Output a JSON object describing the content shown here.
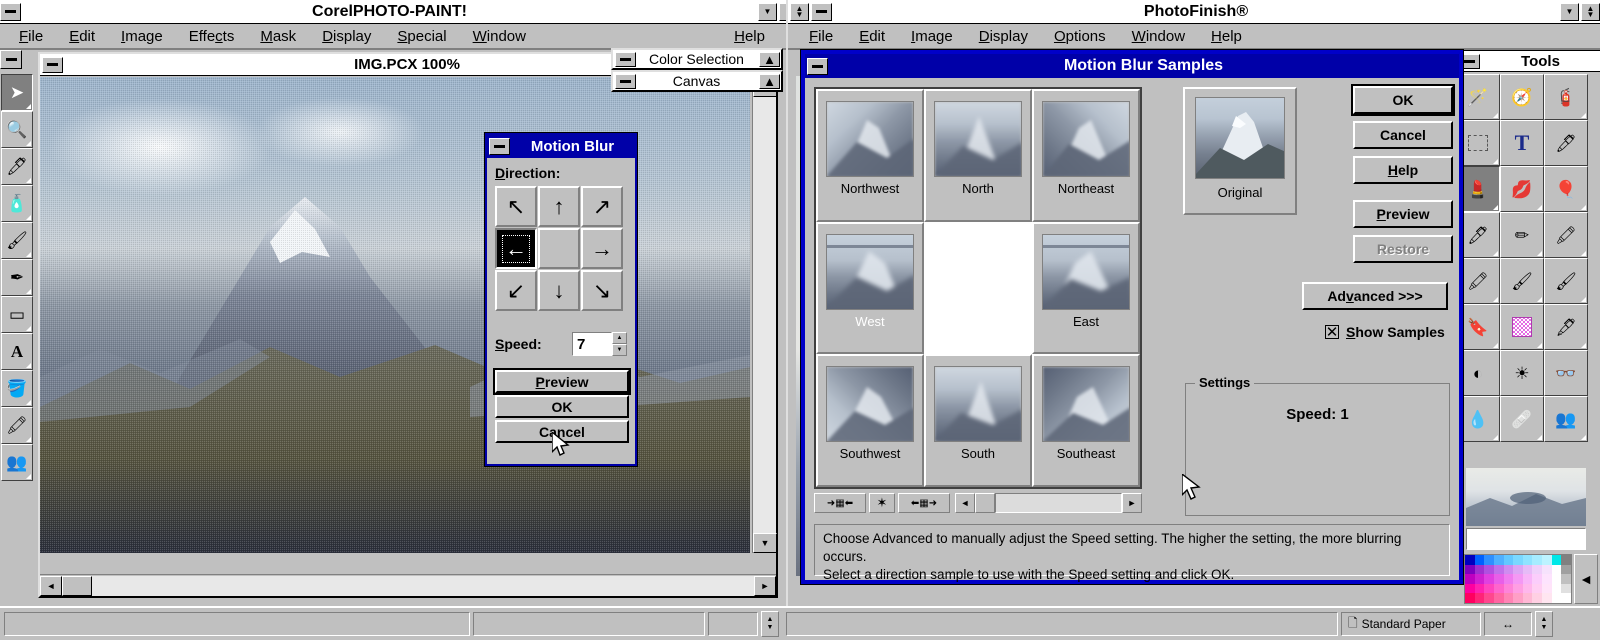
{
  "left_app": {
    "title": "CorelPHOTO-PAINT!",
    "menus": [
      {
        "label": "File",
        "accel": "F"
      },
      {
        "label": "Edit",
        "accel": "E"
      },
      {
        "label": "Image",
        "accel": "I"
      },
      {
        "label": "Effects",
        "accel": "c"
      },
      {
        "label": "Mask",
        "accel": "M"
      },
      {
        "label": "Display",
        "accel": "D"
      },
      {
        "label": "Special",
        "accel": "S"
      },
      {
        "label": "Window",
        "accel": "W"
      }
    ],
    "help_label": "Help",
    "document": {
      "title": "IMG.PCX  100%"
    },
    "panels": [
      {
        "label": "Color Selection"
      },
      {
        "label": "Canvas"
      }
    ],
    "tools": [
      {
        "name": "pick-tool",
        "glyph": "➤",
        "selected": true
      },
      {
        "name": "zoom-tool",
        "glyph": "🔍",
        "selected": false
      },
      {
        "name": "eyedropper-tool",
        "glyph": "🖊",
        "selected": false
      },
      {
        "name": "airbrush-tool",
        "glyph": "🧴",
        "selected": false
      },
      {
        "name": "paint-tool",
        "glyph": "🖌",
        "selected": false
      },
      {
        "name": "brush-tool",
        "glyph": "✒",
        "selected": false
      },
      {
        "name": "rectangle-tool",
        "glyph": "▭",
        "selected": false
      },
      {
        "name": "text-tool",
        "glyph": "A",
        "selected": false
      },
      {
        "name": "fill-tool",
        "glyph": "🪣",
        "selected": false
      },
      {
        "name": "clone-tool",
        "glyph": "🖍",
        "selected": false
      },
      {
        "name": "people-tool",
        "glyph": "👥",
        "selected": false
      }
    ]
  },
  "right_app": {
    "title": "PhotoFinish®",
    "menus": [
      {
        "label": "File",
        "accel": "F"
      },
      {
        "label": "Edit",
        "accel": "E"
      },
      {
        "label": "Image",
        "accel": "I"
      },
      {
        "label": "Display",
        "accel": "D"
      },
      {
        "label": "Options",
        "accel": "O"
      },
      {
        "label": "Window",
        "accel": "W"
      },
      {
        "label": "Help",
        "accel": "H"
      }
    ],
    "tools_panel_title": "Tools",
    "tool_icons": [
      {
        "name": "magic-wand-tool",
        "glyph": "🪄"
      },
      {
        "name": "compass-tool",
        "glyph": "🧭"
      },
      {
        "name": "spray-can-tool",
        "glyph": "🧯"
      },
      {
        "name": "marquee-select-tool",
        "glyph": "⬚"
      },
      {
        "name": "text-tool",
        "glyph": "T"
      },
      {
        "name": "eyedropper-tool",
        "glyph": "🖊"
      },
      {
        "name": "lipstick-tool",
        "glyph": "💄"
      },
      {
        "name": "smear-tool",
        "glyph": "💋"
      },
      {
        "name": "airbrush-tool",
        "glyph": "🎈"
      },
      {
        "name": "marker-tool",
        "glyph": "🖊"
      },
      {
        "name": "pencil-tool",
        "glyph": "✏"
      },
      {
        "name": "chalk-tool",
        "glyph": "🖍"
      },
      {
        "name": "highlighter-magenta-tool",
        "glyph": "🖍"
      },
      {
        "name": "highlighter-yellow-tool",
        "glyph": "🖌"
      },
      {
        "name": "red-brush-tool",
        "glyph": "🖌"
      },
      {
        "name": "stamp-tool",
        "glyph": "🔖"
      },
      {
        "name": "pattern-fill-tool",
        "glyph": "▩"
      },
      {
        "name": "feather-tool",
        "glyph": "🖋"
      },
      {
        "name": "contrast-tool",
        "glyph": "◐"
      },
      {
        "name": "brightness-tool",
        "glyph": "☀"
      },
      {
        "name": "glasses-tool",
        "glyph": "👓"
      },
      {
        "name": "water-drop-tool",
        "glyph": "💧"
      },
      {
        "name": "eraser-tool",
        "glyph": "🩹"
      },
      {
        "name": "clone-people-tool",
        "glyph": "👥"
      }
    ]
  },
  "motion_blur_dialog": {
    "title": "Motion Blur",
    "direction_label": "Direction:",
    "directions": [
      {
        "name": "northwest",
        "glyph": "↖",
        "selected": false
      },
      {
        "name": "north",
        "glyph": "↑",
        "selected": false
      },
      {
        "name": "northeast",
        "glyph": "↗",
        "selected": false
      },
      {
        "name": "west",
        "glyph": "←",
        "selected": true
      },
      {
        "name": "center",
        "glyph": "",
        "selected": false
      },
      {
        "name": "east",
        "glyph": "→",
        "selected": false
      },
      {
        "name": "southwest",
        "glyph": "↙",
        "selected": false
      },
      {
        "name": "south",
        "glyph": "↓",
        "selected": false
      },
      {
        "name": "southeast",
        "glyph": "↘",
        "selected": false
      }
    ],
    "speed_label": "Speed:",
    "speed_value": "7",
    "buttons": {
      "preview": "Preview",
      "ok": "OK",
      "cancel": "Cancel"
    }
  },
  "samples_dialog": {
    "title": "Motion Blur Samples",
    "samples": [
      {
        "label": "Northwest",
        "selected": false,
        "blank": false,
        "dir": "nw"
      },
      {
        "label": "North",
        "selected": false,
        "blank": false,
        "dir": "n"
      },
      {
        "label": "Northeast",
        "selected": false,
        "blank": false,
        "dir": "ne"
      },
      {
        "label": "West",
        "selected": true,
        "blank": false,
        "dir": "w"
      },
      {
        "label": "",
        "selected": false,
        "blank": true,
        "dir": ""
      },
      {
        "label": "East",
        "selected": false,
        "blank": false,
        "dir": "e"
      },
      {
        "label": "Southwest",
        "selected": false,
        "blank": false,
        "dir": "sw"
      },
      {
        "label": "South",
        "selected": false,
        "blank": false,
        "dir": "s"
      },
      {
        "label": "Southeast",
        "selected": false,
        "blank": false,
        "dir": "se"
      }
    ],
    "original_label": "Original",
    "buttons": {
      "ok": "OK",
      "cancel": "Cancel",
      "help": "Help",
      "preview": "Preview",
      "restore": "Restore",
      "advanced": "Advanced >>>"
    },
    "restore_disabled": true,
    "show_samples_label": "Show Samples",
    "show_samples_checked": true,
    "settings_legend": "Settings",
    "settings_speed": "Speed: 1",
    "help_text_line1": "Choose Advanced to manually adjust the Speed setting. The higher the setting, the more blurring occurs.",
    "help_text_line2": "Select a direction sample to use with the Speed setting and click OK.",
    "navbar": [
      {
        "name": "shrink-grid-button",
        "glyph": "➜▦⬅"
      },
      {
        "name": "scatter-button",
        "glyph": "✶"
      },
      {
        "name": "expand-grid-button",
        "glyph": "⬅▦➜"
      }
    ]
  },
  "statusbar": {
    "paper_label": "Standard Paper",
    "resize_icon": "↔"
  },
  "colors": {
    "title_active": "#0000a8",
    "face": "#c0c0c0",
    "shadow": "#808080",
    "highlight": "#ffffff",
    "text": "#000000"
  }
}
